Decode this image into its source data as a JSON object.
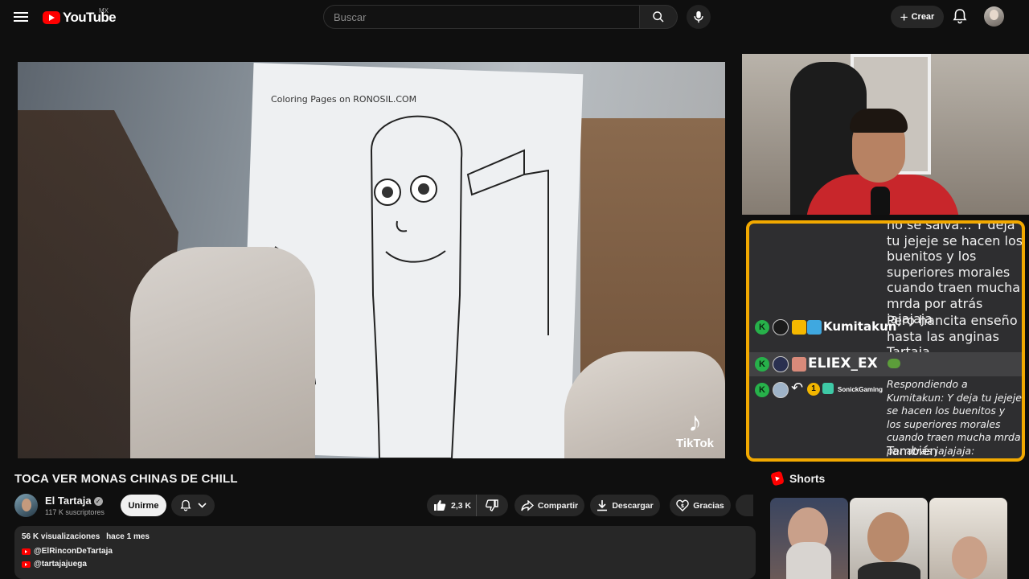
{
  "header": {
    "logo_text": "YouTube",
    "country_code": "MX",
    "search_placeholder": "Buscar",
    "create_label": "Crear",
    "icons": [
      "menu-icon",
      "search-icon",
      "mic-icon",
      "bell-icon"
    ]
  },
  "video": {
    "paper_brand": "Coloring Pages on RONOSIL.COM",
    "watermark": "TikTok",
    "title": "TOCA VER MONAS CHINAS DE CHILL"
  },
  "chat": {
    "messages": [
      {
        "text": "no se salva... Y deja tu jejeje se hacen los buenitos y los superiores morales cuando traen mucha mrda por atrás jajajaja"
      },
      {
        "user": "Kumitakun",
        "text": "Pero hancita enseño hasta las anginas Tartaja"
      },
      {
        "user": "ELIEX_EX",
        "text": ""
      },
      {
        "user": "SonickGaming",
        "text": "Respondiendo a Kumitakun: Y deja tu jejeje se hacen los buenitos y los superiores morales cuando traen mucha mrda por atrás jajajaja:",
        "reply": "También",
        "badge_number": "1"
      }
    ],
    "badge_letter": "K",
    "border_color": "#f2a900"
  },
  "channel": {
    "name": "El Tartaja",
    "subscribers": "117 K suscriptores",
    "join_label": "Unirme"
  },
  "actions": {
    "likes": "2,3 K",
    "share_label": "Compartir",
    "download_label": "Descargar",
    "thanks_label": "Gracias"
  },
  "description": {
    "views": "56 K visualizaciones",
    "date": "hace 1 mes",
    "links": [
      "@ElRinconDeTartaja",
      "@tartajajuega"
    ]
  },
  "sidebar": {
    "shorts_label": "Shorts"
  },
  "colors": {
    "background": "#0f0f0f",
    "brand_red": "#ff0000",
    "pill": "#272727"
  }
}
